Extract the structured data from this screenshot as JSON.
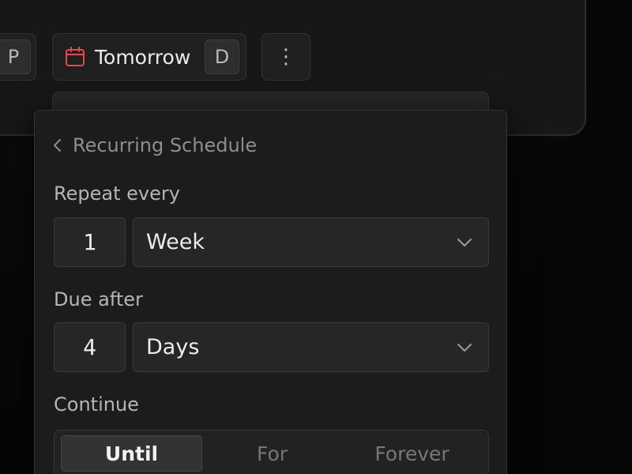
{
  "toolbar": {
    "left_chip_shortcut": "P",
    "date_chip": {
      "label": "Tomorrow",
      "shortcut": "D",
      "icon": "calendar-icon",
      "icon_color": "#e5484d"
    },
    "more_button": {
      "label": "⋮",
      "icon": "more-vertical-icon"
    }
  },
  "popover": {
    "title": "Recurring Schedule",
    "back_icon": "chevron-left-icon",
    "repeat": {
      "label": "Repeat every",
      "interval": "1",
      "unit": "Week"
    },
    "due": {
      "label": "Due after",
      "interval": "4",
      "unit": "Days"
    },
    "continue": {
      "label": "Continue",
      "options": [
        "Until",
        "For",
        "Forever"
      ],
      "selected": "Until"
    }
  }
}
